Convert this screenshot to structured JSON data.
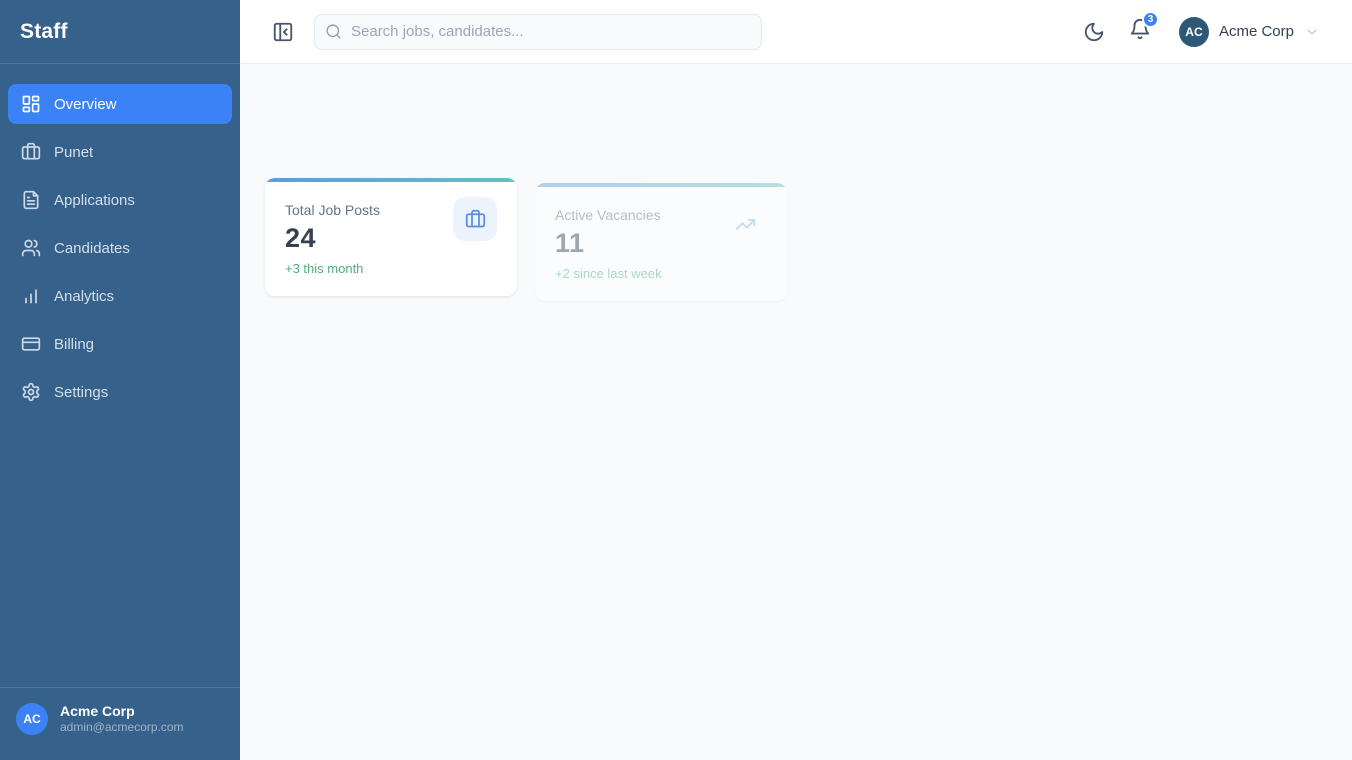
{
  "app": {
    "title": "Staff"
  },
  "sidebar": {
    "logo": "Staff",
    "items": [
      {
        "label": "Overview",
        "icon": "layout-dashboard-icon",
        "active": true
      },
      {
        "label": "Punet",
        "icon": "briefcase-icon",
        "active": false
      },
      {
        "label": "Applications",
        "icon": "file-text-icon",
        "active": false
      },
      {
        "label": "Candidates",
        "icon": "users-icon",
        "active": false
      },
      {
        "label": "Analytics",
        "icon": "bar-chart-icon",
        "active": false
      },
      {
        "label": "Billing",
        "icon": "credit-card-icon",
        "active": false
      },
      {
        "label": "Settings",
        "icon": "gear-icon",
        "active": false
      }
    ],
    "user": {
      "initials": "AC",
      "name": "Acme Corp",
      "email": "admin@acmecorp.com"
    }
  },
  "topbar": {
    "search_placeholder": "Search jobs, candidates...",
    "notifications_count": "3",
    "account": {
      "initials": "AC",
      "name": "Acme Corp"
    }
  },
  "stats": {
    "cards": [
      {
        "label": "Total Job Posts",
        "value": "24",
        "delta": "+3 this month",
        "icon": "briefcase-icon"
      },
      {
        "label": "Active Vacancies",
        "value": "11",
        "delta": "+2 since last week",
        "icon": "trending-up-icon"
      }
    ]
  },
  "colors": {
    "sidebar_bg": "#35618b",
    "active_item": "#3b82f6",
    "badge": "#3b82f6",
    "card_accent_start": "#5b9de2",
    "card_accent_end": "#63c1bd",
    "delta_green": "#4fae80"
  }
}
